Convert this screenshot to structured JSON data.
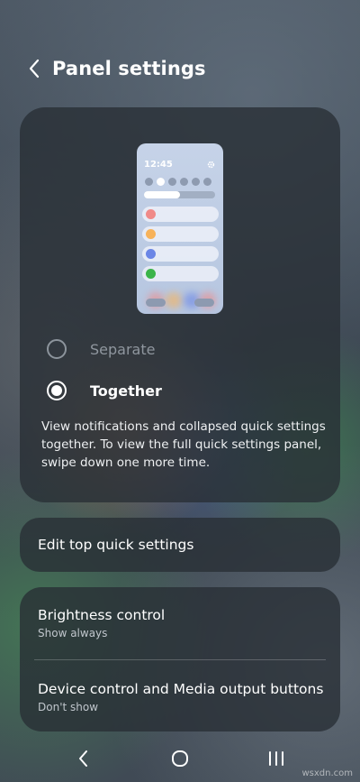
{
  "header": {
    "title": "Panel settings",
    "back_icon": "chevron-left-icon"
  },
  "preview": {
    "time": "12:45",
    "gear_icon": "gear-icon",
    "brightness_fraction": 0.5,
    "notification_colors": [
      "#f08a88",
      "#f7b25a",
      "#6b86e6",
      "#3bb44a"
    ]
  },
  "options": [
    {
      "label": "Separate",
      "selected": false
    },
    {
      "label": "Together",
      "selected": true
    }
  ],
  "description": "View notifications and collapsed quick settings together. To view the full quick settings panel, swipe down one more time.",
  "edit": {
    "label": "Edit top quick settings"
  },
  "list": [
    {
      "title": "Brightness control",
      "subtitle": "Show always"
    },
    {
      "title": "Device control and Media output buttons",
      "subtitle": "Don't show"
    }
  ],
  "navbar": {
    "back_icon": "back-icon",
    "home_icon": "home-icon",
    "recents_icon": "recents-icon"
  },
  "watermark": "wsxdn.com"
}
